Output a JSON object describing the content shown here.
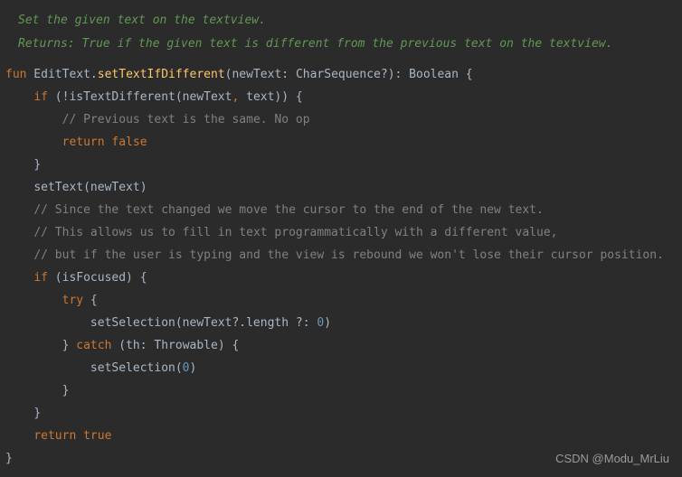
{
  "doc": {
    "line1": "Set the given text on the textview.",
    "line2": "Returns: True if the given text is different from the previous text on the textview."
  },
  "code": {
    "kw_fun": "fun",
    "type_edittext": " EditText.",
    "fn_name": "setTextIfDifferent",
    "sig_open": "(",
    "param_name": "newText",
    "param_colon": ": ",
    "param_type": "CharSequence?",
    "sig_close": ")",
    "ret_colon": ": ",
    "ret_type": "Boolean",
    "brace_open": " {",
    "kw_if": "if",
    "if1_cond": " (!isTextDifferent(newText",
    "comma": ",",
    "if1_cond2": " text)) {",
    "comment_prev": "// Previous text is the same. No op",
    "kw_return": "return",
    "kw_false": " false",
    "brace_close": "}",
    "settext_call": "setText(newText)",
    "comment_since": "// Since the text changed we move the cursor to the end of the new text.",
    "comment_allows": "// This allows us to fill in text programmatically with a different value,",
    "comment_but": "// but if the user is typing and the view is rebound we won't lose their cursor position.",
    "if2_cond": " (isFocused) {",
    "kw_try": "try",
    "try_brace": " {",
    "setsel1_a": "setSelection(newText?.length ?: ",
    "zero": "0",
    "setsel1_b": ")",
    "brace_close_try": "} ",
    "kw_catch": "catch",
    "catch_sig": " (th: Throwable) {",
    "setsel2_a": "setSelection(",
    "setsel2_b": ")",
    "kw_true": " true"
  },
  "watermark": "CSDN @Modu_MrLiu"
}
